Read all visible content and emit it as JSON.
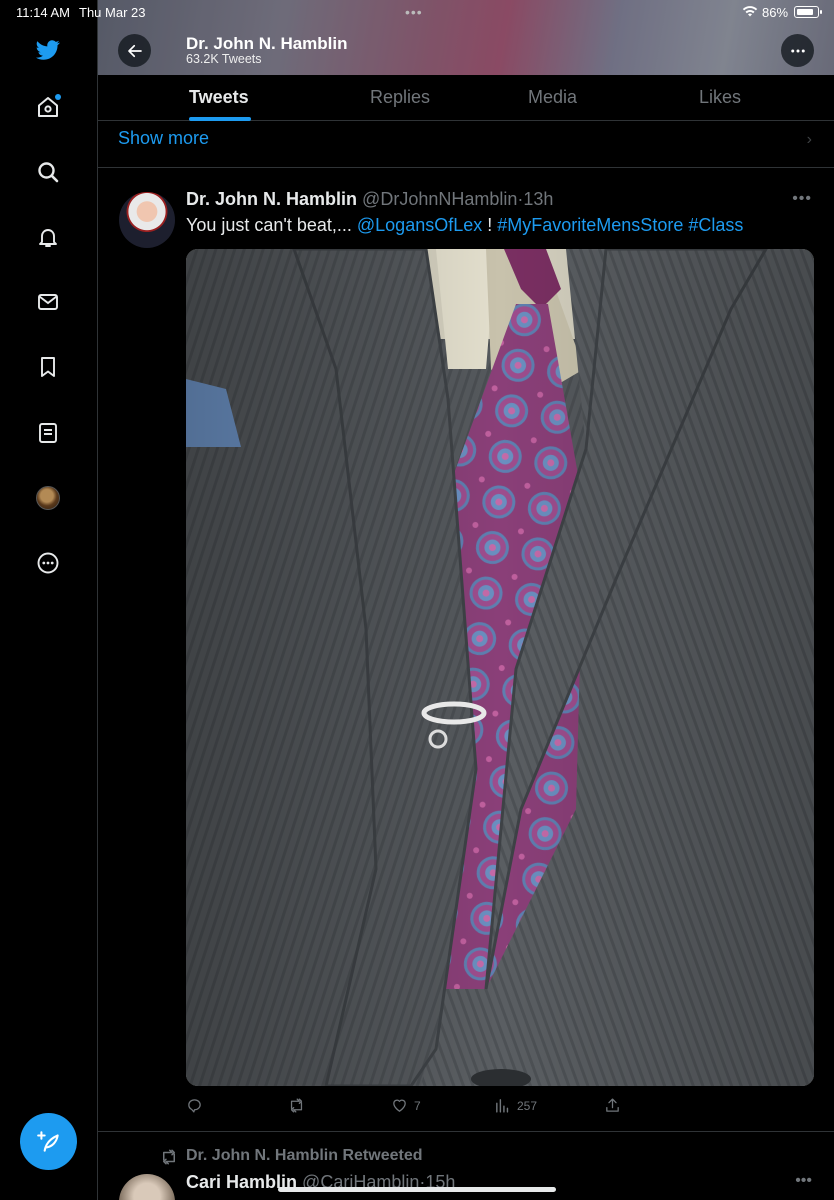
{
  "status_bar": {
    "time": "11:14 AM",
    "date": "Thu Mar 23",
    "battery": "86%",
    "battery_level": 0.86
  },
  "sidebar": {
    "items": [
      {
        "icon": "twitter-logo-icon"
      },
      {
        "icon": "home-icon"
      },
      {
        "icon": "search-icon"
      },
      {
        "icon": "bell-icon"
      },
      {
        "icon": "mail-icon"
      },
      {
        "icon": "bookmark-icon"
      },
      {
        "icon": "lists-icon"
      },
      {
        "icon": "profile-avatar"
      },
      {
        "icon": "more-circle-icon"
      }
    ],
    "compose_icon": "compose-feather-icon"
  },
  "header": {
    "name": "Dr. John N. Hamblin",
    "tweet_count": "63.2K Tweets"
  },
  "tabs": [
    {
      "label": "Tweets",
      "active": true
    },
    {
      "label": "Replies",
      "active": false
    },
    {
      "label": "Media",
      "active": false
    },
    {
      "label": "Likes",
      "active": false
    }
  ],
  "show_more": "Show more",
  "tweet": {
    "name": "Dr. John N. Hamblin",
    "handle": "@DrJohnNHamblin",
    "separator": "·",
    "time": "13h",
    "text_plain": "You just can't beat,... ",
    "mention": "@LogansOfLex",
    "text_mid": " ! ",
    "hashtag1": "#MyFavoriteMensStore",
    "hashtag2": "#Class",
    "actions": {
      "reply": "",
      "retweet": "",
      "likes": "7",
      "views": "257"
    }
  },
  "next_tweet": {
    "retweeted_by": "Dr. John N. Hamblin Retweeted",
    "name": "Cari Hamblin",
    "handle": "@CariHamblin",
    "separator": "·",
    "time": "15h"
  },
  "colors": {
    "accent": "#1d9bf0",
    "background": "#000000",
    "secondary_text": "#71767b",
    "divider": "#2f3336"
  }
}
